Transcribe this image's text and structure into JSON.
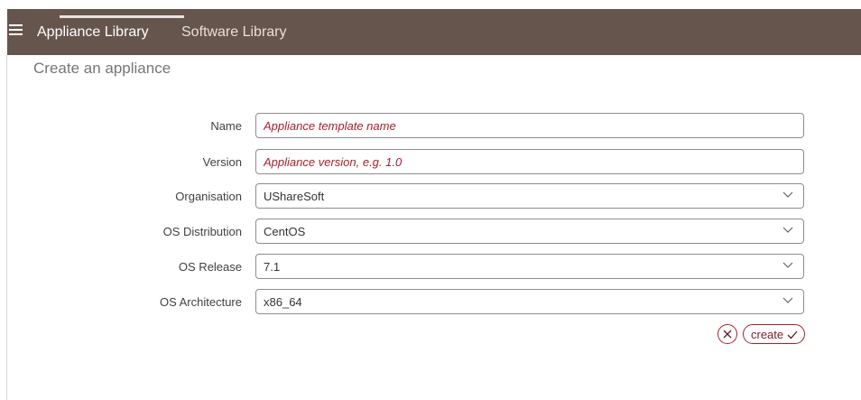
{
  "topbar": {
    "menu_icon": "hamburger-icon",
    "tabs": [
      {
        "label": "Appliance Library",
        "active": true
      },
      {
        "label": "Software Library",
        "active": false
      }
    ],
    "background": "#66554d"
  },
  "page": {
    "title": "Create an appliance"
  },
  "form": {
    "name": {
      "label": "Name",
      "value": "",
      "placeholder": "Appliance template name"
    },
    "version": {
      "label": "Version",
      "value": "",
      "placeholder": "Appliance version, e.g. 1.0"
    },
    "organisation": {
      "label": "Organisation",
      "value": "UShareSoft",
      "icon": "chevron-down-icon"
    },
    "os_distribution": {
      "label": "OS Distribution",
      "value": "CentOS",
      "icon": "chevron-down-icon"
    },
    "os_release": {
      "label": "OS Release",
      "value": "7.1",
      "icon": "chevron-down-icon"
    },
    "os_architecture": {
      "label": "OS Architecture",
      "value": "x86_64",
      "icon": "chevron-down-icon"
    }
  },
  "actions": {
    "cancel_icon": "close-icon",
    "create_label": "create",
    "create_icon": "check-icon",
    "accent": "#a5202c"
  }
}
